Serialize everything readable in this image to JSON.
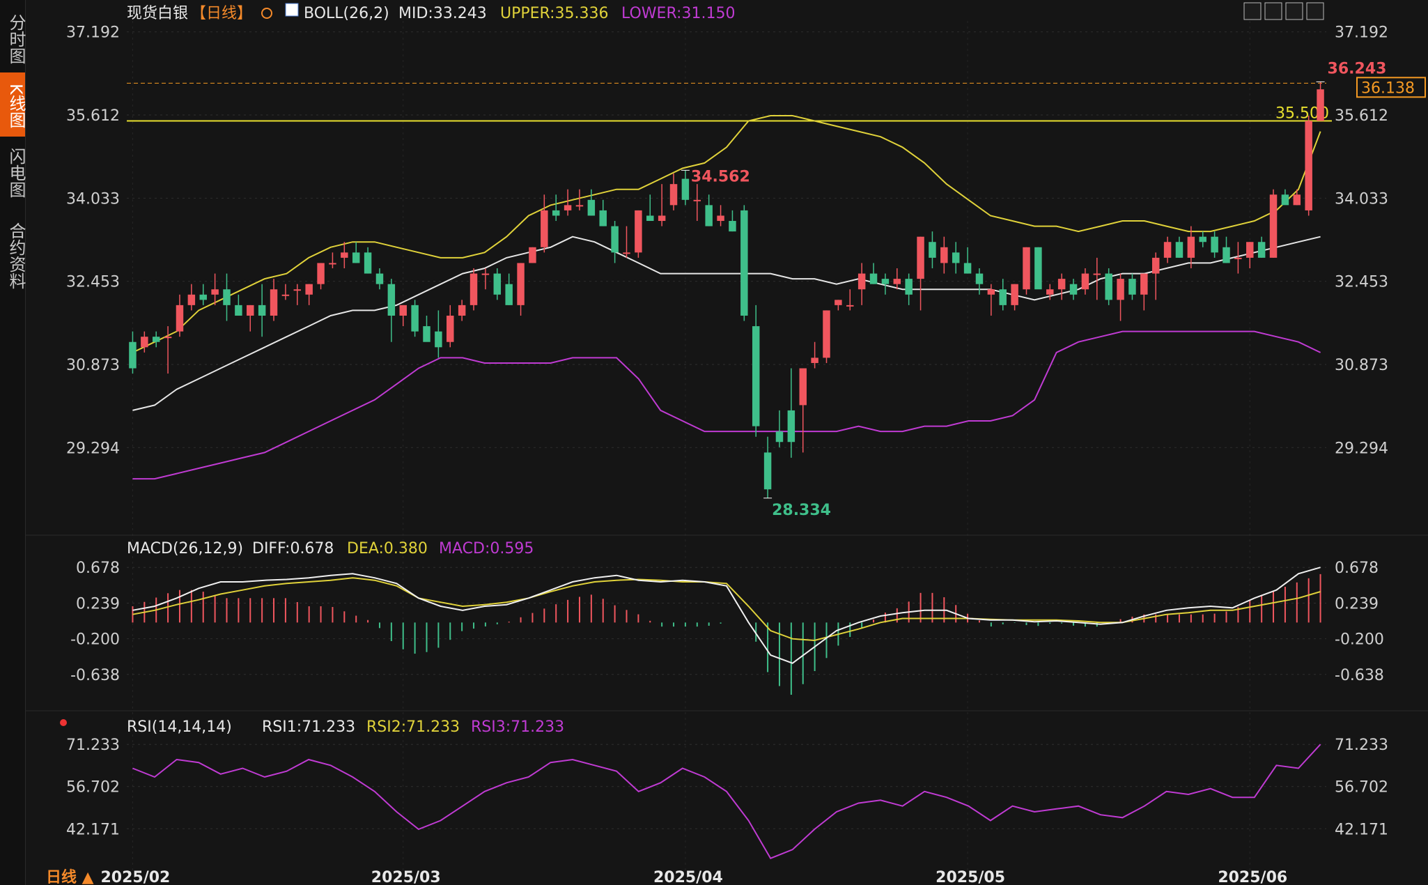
{
  "sidebar": {
    "tabs": [
      {
        "label": "分时图",
        "active": false
      },
      {
        "label": "K线图",
        "active": true
      },
      {
        "label": "闪电图",
        "active": false
      },
      {
        "label": "合约资料",
        "active": false
      }
    ]
  },
  "header": {
    "symbol": "现货白银",
    "period": "【日线】",
    "boll_label": "BOLL(26,2)",
    "mid_label": "MID:33.243",
    "upper_label": "UPPER:35.336",
    "lower_label": "LOWER:31.150",
    "toolbar_icons": [
      "grid-icon",
      "bar-chart-icon",
      "line-chart-icon",
      "expand-icon"
    ]
  },
  "colors": {
    "background": "#151515",
    "up": "#f0565e",
    "down": "#3fbf8a",
    "boll_mid": "#e6e6e6",
    "boll_upper": "#e0d23a",
    "boll_lower": "#c03bd3",
    "price_line": "#f59a23",
    "level_line": "#e8e02e"
  },
  "chart_data": [
    {
      "type": "candlestick",
      "title": "现货白银 日线",
      "x": [
        "2025/02",
        "2025/03",
        "2025/04",
        "2025/05",
        "2025/06"
      ],
      "ylim": [
        28.0,
        37.4
      ],
      "y_ticks": [
        "37.192",
        "35.612",
        "34.033",
        "32.453",
        "30.873",
        "29.294"
      ],
      "ohlc": [
        [
          31.3,
          31.5,
          30.7,
          30.8
        ],
        [
          31.2,
          31.5,
          31.1,
          31.4
        ],
        [
          31.4,
          31.5,
          31.2,
          31.3
        ],
        [
          31.4,
          31.6,
          30.7,
          31.4
        ],
        [
          31.5,
          32.2,
          31.4,
          32.0
        ],
        [
          32.0,
          32.4,
          31.9,
          32.2
        ],
        [
          32.2,
          32.4,
          32.0,
          32.1
        ],
        [
          32.2,
          32.6,
          32.0,
          32.3
        ],
        [
          32.3,
          32.6,
          31.7,
          32.0
        ],
        [
          32.0,
          32.2,
          31.8,
          31.8
        ],
        [
          31.8,
          32.0,
          31.5,
          32.0
        ],
        [
          32.0,
          32.4,
          31.4,
          31.8
        ],
        [
          31.8,
          32.5,
          31.7,
          32.3
        ],
        [
          32.2,
          32.4,
          32.1,
          32.2
        ],
        [
          32.3,
          32.4,
          32.0,
          32.3
        ],
        [
          32.2,
          32.4,
          32.0,
          32.4
        ],
        [
          32.4,
          32.8,
          32.3,
          32.8
        ],
        [
          32.8,
          33.0,
          32.7,
          32.8
        ],
        [
          32.9,
          33.2,
          32.7,
          33.0
        ],
        [
          33.0,
          33.2,
          32.8,
          32.8
        ],
        [
          33.0,
          33.1,
          32.6,
          32.6
        ],
        [
          32.6,
          32.7,
          32.3,
          32.4
        ],
        [
          32.4,
          32.5,
          31.3,
          31.8
        ],
        [
          31.8,
          32.0,
          31.6,
          32.0
        ],
        [
          32.0,
          32.1,
          31.4,
          31.5
        ],
        [
          31.6,
          31.8,
          31.4,
          31.3
        ],
        [
          31.5,
          31.9,
          31.0,
          31.2
        ],
        [
          31.3,
          32.0,
          31.2,
          31.8
        ],
        [
          31.8,
          32.1,
          31.7,
          32.0
        ],
        [
          32.0,
          32.7,
          31.9,
          32.6
        ],
        [
          32.6,
          32.7,
          32.3,
          32.6
        ],
        [
          32.6,
          32.7,
          32.1,
          32.2
        ],
        [
          32.4,
          32.6,
          32.0,
          32.0
        ],
        [
          32.0,
          32.8,
          31.8,
          32.8
        ],
        [
          32.8,
          33.1,
          32.8,
          33.1
        ],
        [
          33.1,
          34.1,
          33.0,
          33.8
        ],
        [
          33.8,
          34.1,
          33.6,
          33.7
        ],
        [
          33.8,
          34.2,
          33.7,
          33.9
        ],
        [
          33.9,
          34.2,
          33.8,
          33.9
        ],
        [
          34.0,
          34.2,
          33.7,
          33.7
        ],
        [
          33.8,
          34.0,
          33.5,
          33.5
        ],
        [
          33.5,
          33.6,
          32.8,
          33.0
        ],
        [
          33.0,
          33.5,
          32.9,
          33.0
        ],
        [
          33.0,
          33.8,
          32.9,
          33.8
        ],
        [
          33.7,
          34.1,
          33.6,
          33.6
        ],
        [
          33.6,
          34.3,
          33.5,
          33.7
        ],
        [
          33.9,
          34.5,
          33.8,
          34.3
        ],
        [
          34.4,
          34.56,
          33.9,
          34.0
        ],
        [
          34.0,
          34.3,
          33.6,
          34.0
        ],
        [
          33.9,
          34.1,
          33.5,
          33.5
        ],
        [
          33.6,
          33.9,
          33.5,
          33.7
        ],
        [
          33.6,
          33.8,
          33.4,
          33.4
        ],
        [
          33.8,
          33.9,
          31.7,
          31.8
        ],
        [
          31.6,
          32.0,
          29.5,
          29.7
        ],
        [
          29.2,
          29.5,
          28.334,
          28.5
        ],
        [
          29.6,
          30.0,
          29.3,
          29.4
        ],
        [
          30.0,
          30.8,
          29.1,
          29.4
        ],
        [
          30.1,
          30.8,
          29.2,
          30.8
        ],
        [
          30.9,
          31.3,
          30.8,
          31.0
        ],
        [
          31.0,
          31.9,
          30.9,
          31.9
        ],
        [
          32.0,
          32.1,
          31.9,
          32.1
        ],
        [
          32.0,
          32.3,
          31.9,
          32.0
        ],
        [
          32.3,
          32.8,
          32.0,
          32.6
        ],
        [
          32.6,
          32.8,
          32.4,
          32.4
        ],
        [
          32.5,
          32.6,
          32.2,
          32.4
        ],
        [
          32.4,
          32.7,
          32.3,
          32.5
        ],
        [
          32.5,
          32.6,
          32.0,
          32.2
        ],
        [
          32.5,
          33.3,
          31.9,
          33.3
        ],
        [
          33.2,
          33.4,
          32.7,
          32.9
        ],
        [
          32.8,
          33.3,
          32.6,
          33.1
        ],
        [
          33.0,
          33.2,
          32.6,
          32.8
        ],
        [
          32.8,
          33.1,
          32.6,
          32.6
        ],
        [
          32.6,
          32.7,
          32.2,
          32.4
        ],
        [
          32.2,
          32.4,
          31.8,
          32.3
        ],
        [
          32.3,
          32.5,
          31.9,
          32.0
        ],
        [
          32.0,
          32.4,
          31.9,
          32.4
        ],
        [
          32.3,
          33.1,
          32.2,
          33.1
        ],
        [
          33.1,
          33.1,
          32.4,
          32.3
        ],
        [
          32.2,
          32.4,
          32.1,
          32.3
        ],
        [
          32.3,
          32.6,
          32.1,
          32.5
        ],
        [
          32.4,
          32.5,
          32.1,
          32.2
        ],
        [
          32.3,
          32.7,
          32.2,
          32.6
        ],
        [
          32.6,
          32.9,
          32.1,
          32.6
        ],
        [
          32.6,
          32.7,
          32.0,
          32.1
        ],
        [
          32.1,
          32.6,
          31.7,
          32.5
        ],
        [
          32.5,
          32.6,
          32.1,
          32.2
        ],
        [
          32.2,
          32.6,
          31.9,
          32.6
        ],
        [
          32.6,
          33.0,
          32.1,
          32.9
        ],
        [
          32.9,
          33.3,
          32.8,
          33.2
        ],
        [
          33.2,
          33.3,
          32.9,
          32.9
        ],
        [
          32.9,
          33.5,
          32.7,
          33.3
        ],
        [
          33.3,
          33.4,
          33.1,
          33.2
        ],
        [
          33.3,
          33.4,
          32.9,
          33.0
        ],
        [
          33.1,
          33.3,
          32.8,
          32.8
        ],
        [
          32.9,
          33.2,
          32.6,
          32.9
        ],
        [
          32.9,
          33.2,
          32.7,
          33.2
        ],
        [
          33.2,
          33.3,
          32.9,
          32.9
        ],
        [
          32.9,
          34.2,
          32.9,
          34.1
        ],
        [
          34.1,
          34.2,
          34.0,
          33.9
        ],
        [
          33.9,
          34.2,
          33.9,
          34.1
        ],
        [
          33.8,
          35.6,
          33.7,
          35.5
        ],
        [
          35.5,
          36.243,
          35.5,
          36.1
        ]
      ],
      "boll_upper": [
        31.1,
        31.3,
        31.5,
        31.9,
        32.1,
        32.3,
        32.5,
        32.6,
        32.9,
        33.1,
        33.2,
        33.2,
        33.1,
        33.0,
        32.9,
        32.9,
        33.0,
        33.3,
        33.7,
        33.9,
        34.0,
        34.1,
        34.2,
        34.2,
        34.4,
        34.6,
        34.7,
        35.0,
        35.5,
        35.6,
        35.6,
        35.5,
        35.4,
        35.3,
        35.2,
        35.0,
        34.7,
        34.3,
        34.0,
        33.7,
        33.6,
        33.5,
        33.5,
        33.4,
        33.5,
        33.6,
        33.6,
        33.5,
        33.4,
        33.4,
        33.5,
        33.6,
        33.8,
        34.2,
        35.3
      ],
      "boll_mid": [
        30.0,
        30.1,
        30.4,
        30.6,
        30.8,
        31.0,
        31.2,
        31.4,
        31.6,
        31.8,
        31.9,
        31.9,
        32.0,
        32.2,
        32.4,
        32.6,
        32.7,
        32.9,
        33.0,
        33.1,
        33.3,
        33.2,
        33.0,
        32.8,
        32.6,
        32.6,
        32.6,
        32.6,
        32.6,
        32.6,
        32.5,
        32.5,
        32.4,
        32.5,
        32.4,
        32.3,
        32.3,
        32.3,
        32.3,
        32.3,
        32.2,
        32.1,
        32.2,
        32.3,
        32.5,
        32.6,
        32.6,
        32.7,
        32.8,
        32.8,
        32.9,
        33.0,
        33.1,
        33.2,
        33.3
      ],
      "boll_lower": [
        28.7,
        28.7,
        28.8,
        28.9,
        29.0,
        29.1,
        29.2,
        29.4,
        29.6,
        29.8,
        30.0,
        30.2,
        30.5,
        30.8,
        31.0,
        31.0,
        30.9,
        30.9,
        30.9,
        30.9,
        31.0,
        31.0,
        31.0,
        30.6,
        30.0,
        29.8,
        29.6,
        29.6,
        29.6,
        29.6,
        29.6,
        29.6,
        29.6,
        29.7,
        29.6,
        29.6,
        29.7,
        29.7,
        29.8,
        29.8,
        29.9,
        30.2,
        31.1,
        31.3,
        31.4,
        31.5,
        31.5,
        31.5,
        31.5,
        31.5,
        31.5,
        31.5,
        31.4,
        31.3,
        31.1
      ],
      "annotations": [
        {
          "label": "34.562",
          "value": 34.562
        },
        {
          "label": "28.334",
          "value": 28.334
        },
        {
          "label": "36.243",
          "value": 36.243
        }
      ],
      "level_line": {
        "label": "35.500",
        "value": 35.5
      },
      "last_price": {
        "label": "36.138",
        "value": 36.138
      }
    },
    {
      "type": "macd",
      "title": "MACD(26,12,9)",
      "diff_label": "DIFF:0.678",
      "dea_label": "DEA:0.380",
      "macd_label": "MACD:0.595",
      "ylim": [
        -1.0,
        0.8
      ],
      "y_ticks": [
        "0.678",
        "0.239",
        "-0.200",
        "-0.638"
      ],
      "diff": [
        0.15,
        0.2,
        0.3,
        0.42,
        0.5,
        0.5,
        0.52,
        0.53,
        0.55,
        0.58,
        0.6,
        0.55,
        0.48,
        0.3,
        0.2,
        0.15,
        0.2,
        0.22,
        0.3,
        0.4,
        0.5,
        0.55,
        0.58,
        0.52,
        0.5,
        0.52,
        0.5,
        0.45,
        0.0,
        -0.4,
        -0.5,
        -0.3,
        -0.1,
        0.0,
        0.08,
        0.12,
        0.15,
        0.15,
        0.05,
        0.03,
        0.03,
        0.01,
        0.02,
        0.0,
        -0.02,
        0.0,
        0.08,
        0.15,
        0.18,
        0.2,
        0.18,
        0.3,
        0.4,
        0.6,
        0.678
      ],
      "dea": [
        0.1,
        0.15,
        0.22,
        0.28,
        0.35,
        0.4,
        0.45,
        0.48,
        0.5,
        0.52,
        0.55,
        0.52,
        0.45,
        0.3,
        0.25,
        0.2,
        0.22,
        0.25,
        0.3,
        0.38,
        0.45,
        0.5,
        0.52,
        0.53,
        0.52,
        0.5,
        0.5,
        0.48,
        0.2,
        -0.1,
        -0.2,
        -0.22,
        -0.15,
        -0.08,
        0.0,
        0.05,
        0.05,
        0.05,
        0.05,
        0.04,
        0.03,
        0.03,
        0.03,
        0.02,
        0.0,
        0.0,
        0.05,
        0.1,
        0.12,
        0.15,
        0.15,
        0.2,
        0.25,
        0.3,
        0.38
      ],
      "macd": [
        0.2,
        0.3,
        0.4,
        0.4,
        0.3,
        0.3,
        0.3,
        0.3,
        0.2,
        0.2,
        0.1,
        0.0,
        -0.3,
        -0.4,
        -0.3,
        -0.1,
        -0.05,
        0.0,
        0.1,
        0.2,
        0.3,
        0.35,
        0.2,
        0.1,
        -0.05,
        -0.05,
        -0.05,
        0.0,
        0.0,
        -0.7,
        -0.9,
        -0.6,
        -0.3,
        -0.1,
        0.1,
        0.2,
        0.4,
        0.3,
        0.1,
        -0.05,
        0.0,
        -0.05,
        0.0,
        -0.05,
        -0.05,
        0.05,
        0.1,
        0.1,
        0.1,
        0.1,
        0.15,
        0.3,
        0.4,
        0.5,
        0.595
      ]
    },
    {
      "type": "line",
      "title": "RSI(14,14,14)",
      "rsi1_label": "RSI1:71.233",
      "rsi2_label": "RSI2:71.233",
      "rsi3_label": "RSI3:71.233",
      "ylim": [
        30,
        78
      ],
      "y_ticks": [
        "71.233",
        "56.702",
        "42.171"
      ],
      "rsi": [
        63,
        60,
        66,
        65,
        61,
        63,
        60,
        62,
        66,
        64,
        60,
        55,
        48,
        42,
        45,
        50,
        55,
        58,
        60,
        65,
        66,
        64,
        62,
        55,
        58,
        63,
        60,
        55,
        45,
        32,
        35,
        42,
        48,
        51,
        52,
        50,
        55,
        53,
        50,
        45,
        50,
        48,
        49,
        50,
        47,
        46,
        50,
        55,
        54,
        56,
        53,
        53,
        64,
        63,
        71.233
      ]
    }
  ],
  "x_axis": {
    "labels": [
      "2025/02",
      "2025/03",
      "2025/04",
      "2025/05",
      "2025/06"
    ]
  },
  "footer": {
    "period_label": "日线 ▲"
  }
}
